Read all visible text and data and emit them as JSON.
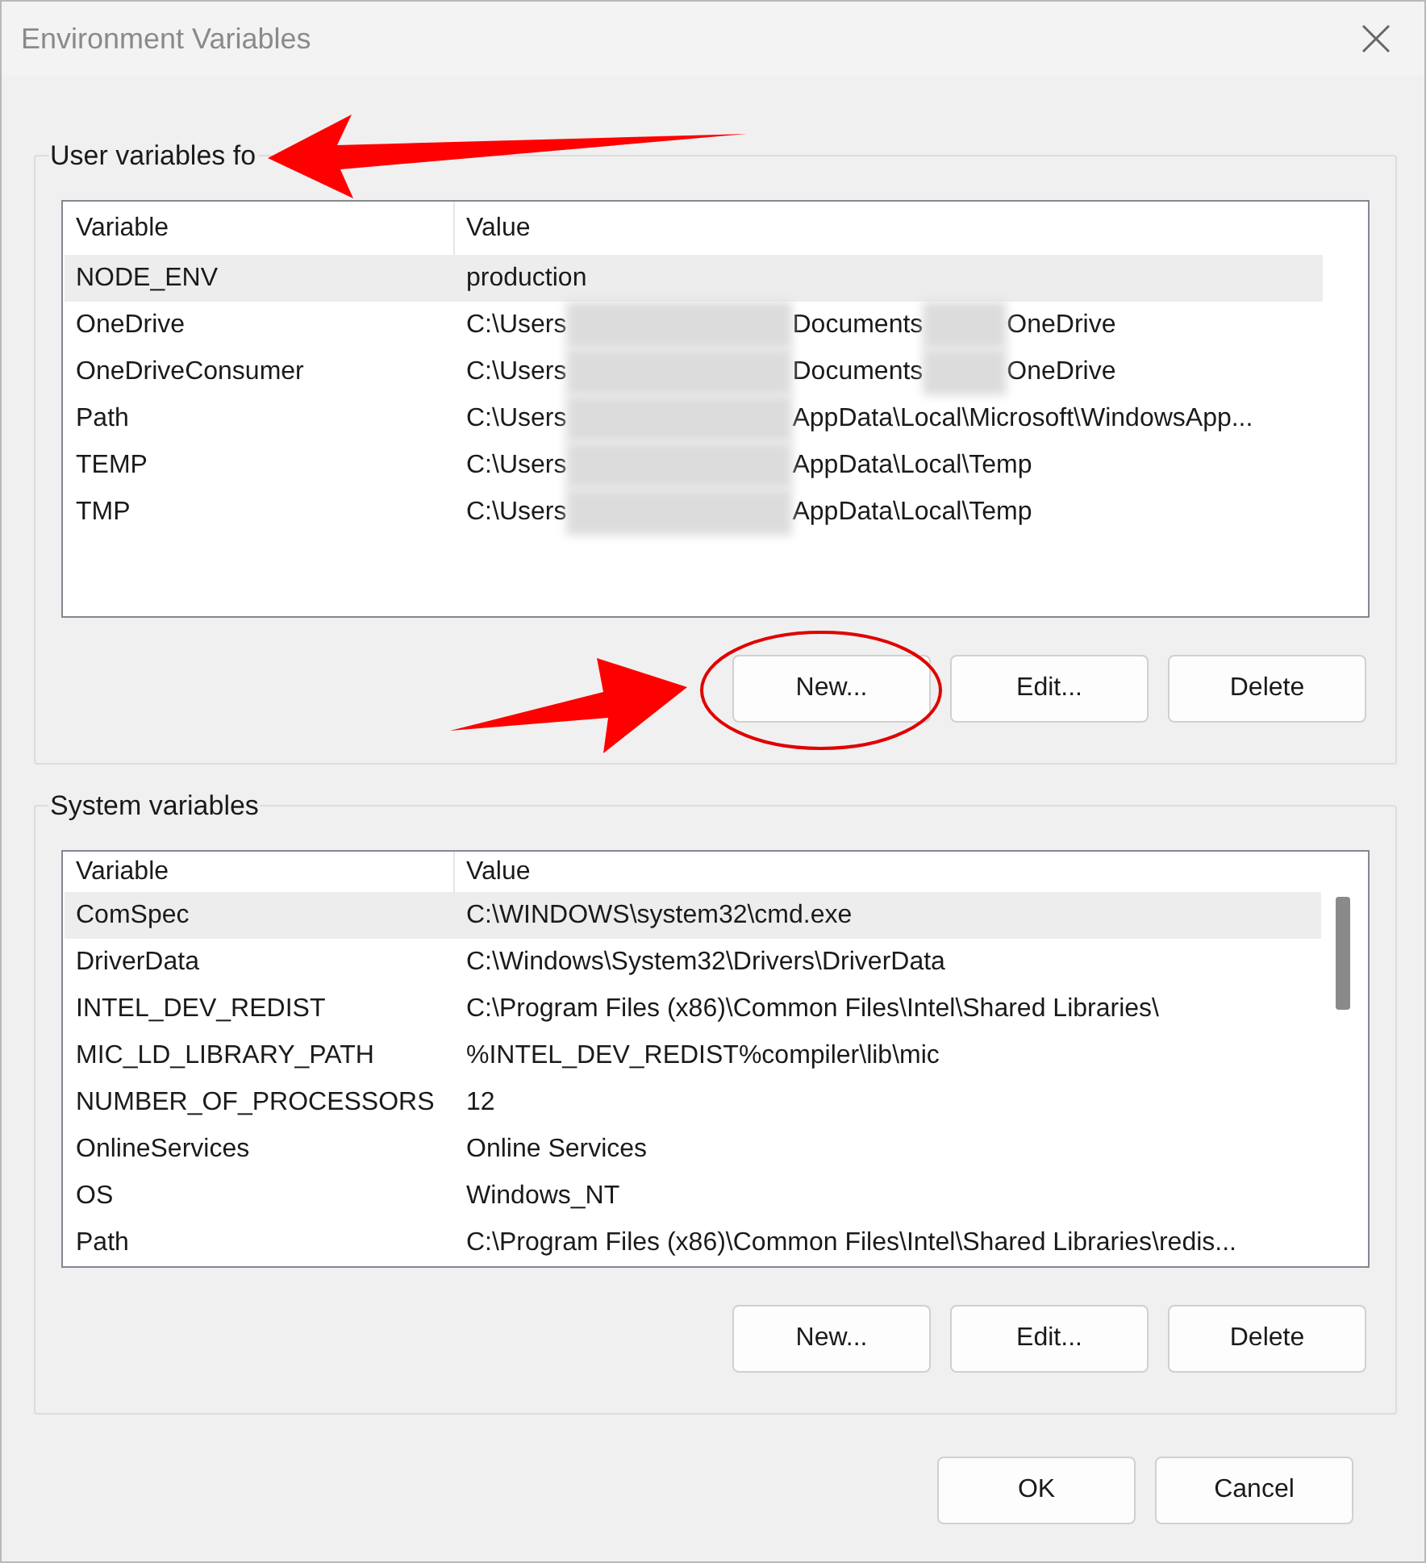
{
  "window": {
    "title": "Environment Variables"
  },
  "user_variables": {
    "label": "User variables fo",
    "columns": [
      "Variable",
      "Value"
    ],
    "rows": [
      {
        "variable": "NODE_ENV",
        "value": [
          {
            "kind": "text",
            "text": "production"
          }
        ],
        "selected": true
      },
      {
        "variable": "OneDrive",
        "value": [
          {
            "kind": "text",
            "text": "C:\\Users"
          },
          {
            "kind": "blur"
          },
          {
            "kind": "text",
            "text": "Documents"
          },
          {
            "kind": "blur"
          },
          {
            "kind": "text",
            "text": "OneDrive"
          }
        ],
        "selected": false
      },
      {
        "variable": "OneDriveConsumer",
        "value": [
          {
            "kind": "text",
            "text": "C:\\Users"
          },
          {
            "kind": "blur"
          },
          {
            "kind": "text",
            "text": "Documents"
          },
          {
            "kind": "blur"
          },
          {
            "kind": "text",
            "text": "OneDrive"
          }
        ],
        "selected": false
      },
      {
        "variable": "Path",
        "value": [
          {
            "kind": "text",
            "text": "C:\\Users"
          },
          {
            "kind": "blur"
          },
          {
            "kind": "text",
            "text": "AppData\\Local\\Microsoft\\WindowsApp..."
          }
        ],
        "selected": false
      },
      {
        "variable": "TEMP",
        "value": [
          {
            "kind": "text",
            "text": "C:\\Users"
          },
          {
            "kind": "blur"
          },
          {
            "kind": "text",
            "text": "AppData\\Local\\Temp"
          }
        ],
        "selected": false
      },
      {
        "variable": "TMP",
        "value": [
          {
            "kind": "text",
            "text": "C:\\Users"
          },
          {
            "kind": "blur"
          },
          {
            "kind": "text",
            "text": "AppData\\Local\\Temp"
          }
        ],
        "selected": false
      }
    ],
    "buttons": [
      "New...",
      "Edit...",
      "Delete"
    ]
  },
  "system_variables": {
    "label": "System variables",
    "columns": [
      "Variable",
      "Value"
    ],
    "rows": [
      {
        "variable": "ComSpec",
        "value": [
          {
            "kind": "text",
            "text": "C:\\WINDOWS\\system32\\cmd.exe"
          }
        ],
        "selected": true
      },
      {
        "variable": "DriverData",
        "value": [
          {
            "kind": "text",
            "text": "C:\\Windows\\System32\\Drivers\\DriverData"
          }
        ],
        "selected": false
      },
      {
        "variable": "INTEL_DEV_REDIST",
        "value": [
          {
            "kind": "text",
            "text": "C:\\Program Files (x86)\\Common Files\\Intel\\Shared Libraries\\"
          }
        ],
        "selected": false
      },
      {
        "variable": "MIC_LD_LIBRARY_PATH",
        "value": [
          {
            "kind": "text",
            "text": "%INTEL_DEV_REDIST%compiler\\lib\\mic"
          }
        ],
        "selected": false
      },
      {
        "variable": "NUMBER_OF_PROCESSORS",
        "value": [
          {
            "kind": "text",
            "text": "12"
          }
        ],
        "selected": false
      },
      {
        "variable": "OnlineServices",
        "value": [
          {
            "kind": "text",
            "text": "Online Services"
          }
        ],
        "selected": false
      },
      {
        "variable": "OS",
        "value": [
          {
            "kind": "text",
            "text": "Windows_NT"
          }
        ],
        "selected": false
      },
      {
        "variable": "Path",
        "value": [
          {
            "kind": "text",
            "text": "C:\\Program Files (x86)\\Common Files\\Intel\\Shared Libraries\\redis..."
          }
        ],
        "selected": false
      }
    ],
    "buttons": [
      "New...",
      "Edit...",
      "Delete"
    ]
  },
  "footer_buttons": [
    "OK",
    "Cancel"
  ],
  "annotations": [
    {
      "kind": "arrow"
    },
    {
      "kind": "arrow"
    },
    {
      "kind": "ellipse"
    }
  ]
}
